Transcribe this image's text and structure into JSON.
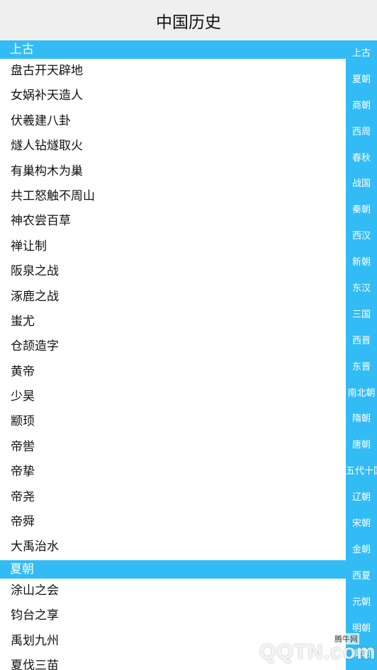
{
  "header": {
    "title": "中国历史"
  },
  "sections": [
    {
      "title": "上古",
      "items": [
        "盘古开天辟地",
        "女娲补天造人",
        "伏羲建八卦",
        "燧人钻燧取火",
        "有巢构木为巢",
        "共工怒触不周山",
        "神农尝百草",
        "禅让制",
        "阪泉之战",
        "涿鹿之战",
        "蚩尤",
        "仓颉造字",
        "黄帝",
        "少昊",
        "颛顼",
        "帝喾",
        "帝挚",
        "帝尧",
        "帝舜",
        "大禹治水"
      ]
    },
    {
      "title": "夏朝",
      "items": [
        "涂山之会",
        "钧台之享",
        "禹划九州",
        "夏伐三苗"
      ]
    }
  ],
  "index": [
    "上古",
    "夏朝",
    "商朝",
    "西周",
    "春秋",
    "战国",
    "秦朝",
    "西汉",
    "新朝",
    "东汉",
    "三国",
    "西晋",
    "东晋",
    "南北朝",
    "隋朝",
    "唐朝",
    "五代十国",
    "辽朝",
    "宋朝",
    "金朝",
    "西夏",
    "元朝",
    "明朝",
    "清朝"
  ],
  "watermark": {
    "text": "QQTN.com",
    "small": "腾牛网"
  },
  "colors": {
    "accent": "#33bbf6",
    "header_bg": "#efeff0"
  }
}
